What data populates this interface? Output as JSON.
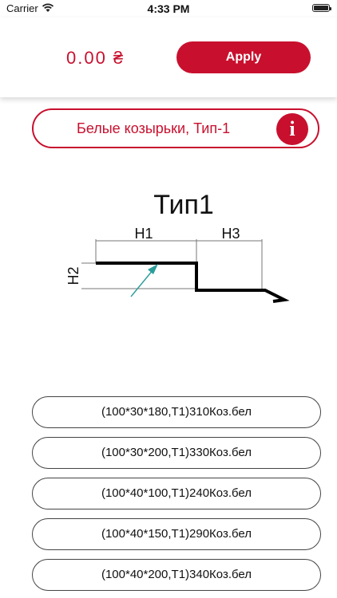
{
  "status_bar": {
    "carrier": "Carrier",
    "time": "4:33 PM"
  },
  "header": {
    "price": "0.00 ₴",
    "apply_label": "Apply"
  },
  "product": {
    "title": "Белые козырьки, Тип-1",
    "info_label": "i"
  },
  "diagram": {
    "title": "Тип1",
    "labels": {
      "h1": "H1",
      "h2": "H2",
      "h3": "H3"
    }
  },
  "options": [
    {
      "label": "(100*30*180,T1)310Коз.бел"
    },
    {
      "label": "(100*30*200,T1)330Коз.бел"
    },
    {
      "label": "(100*40*100,T1)240Коз.бел"
    },
    {
      "label": "(100*40*150,T1)290Коз.бел"
    },
    {
      "label": "(100*40*200,T1)340Коз.бел"
    }
  ],
  "colors": {
    "accent": "#c8102e",
    "arrow": "#2a9d9a"
  }
}
